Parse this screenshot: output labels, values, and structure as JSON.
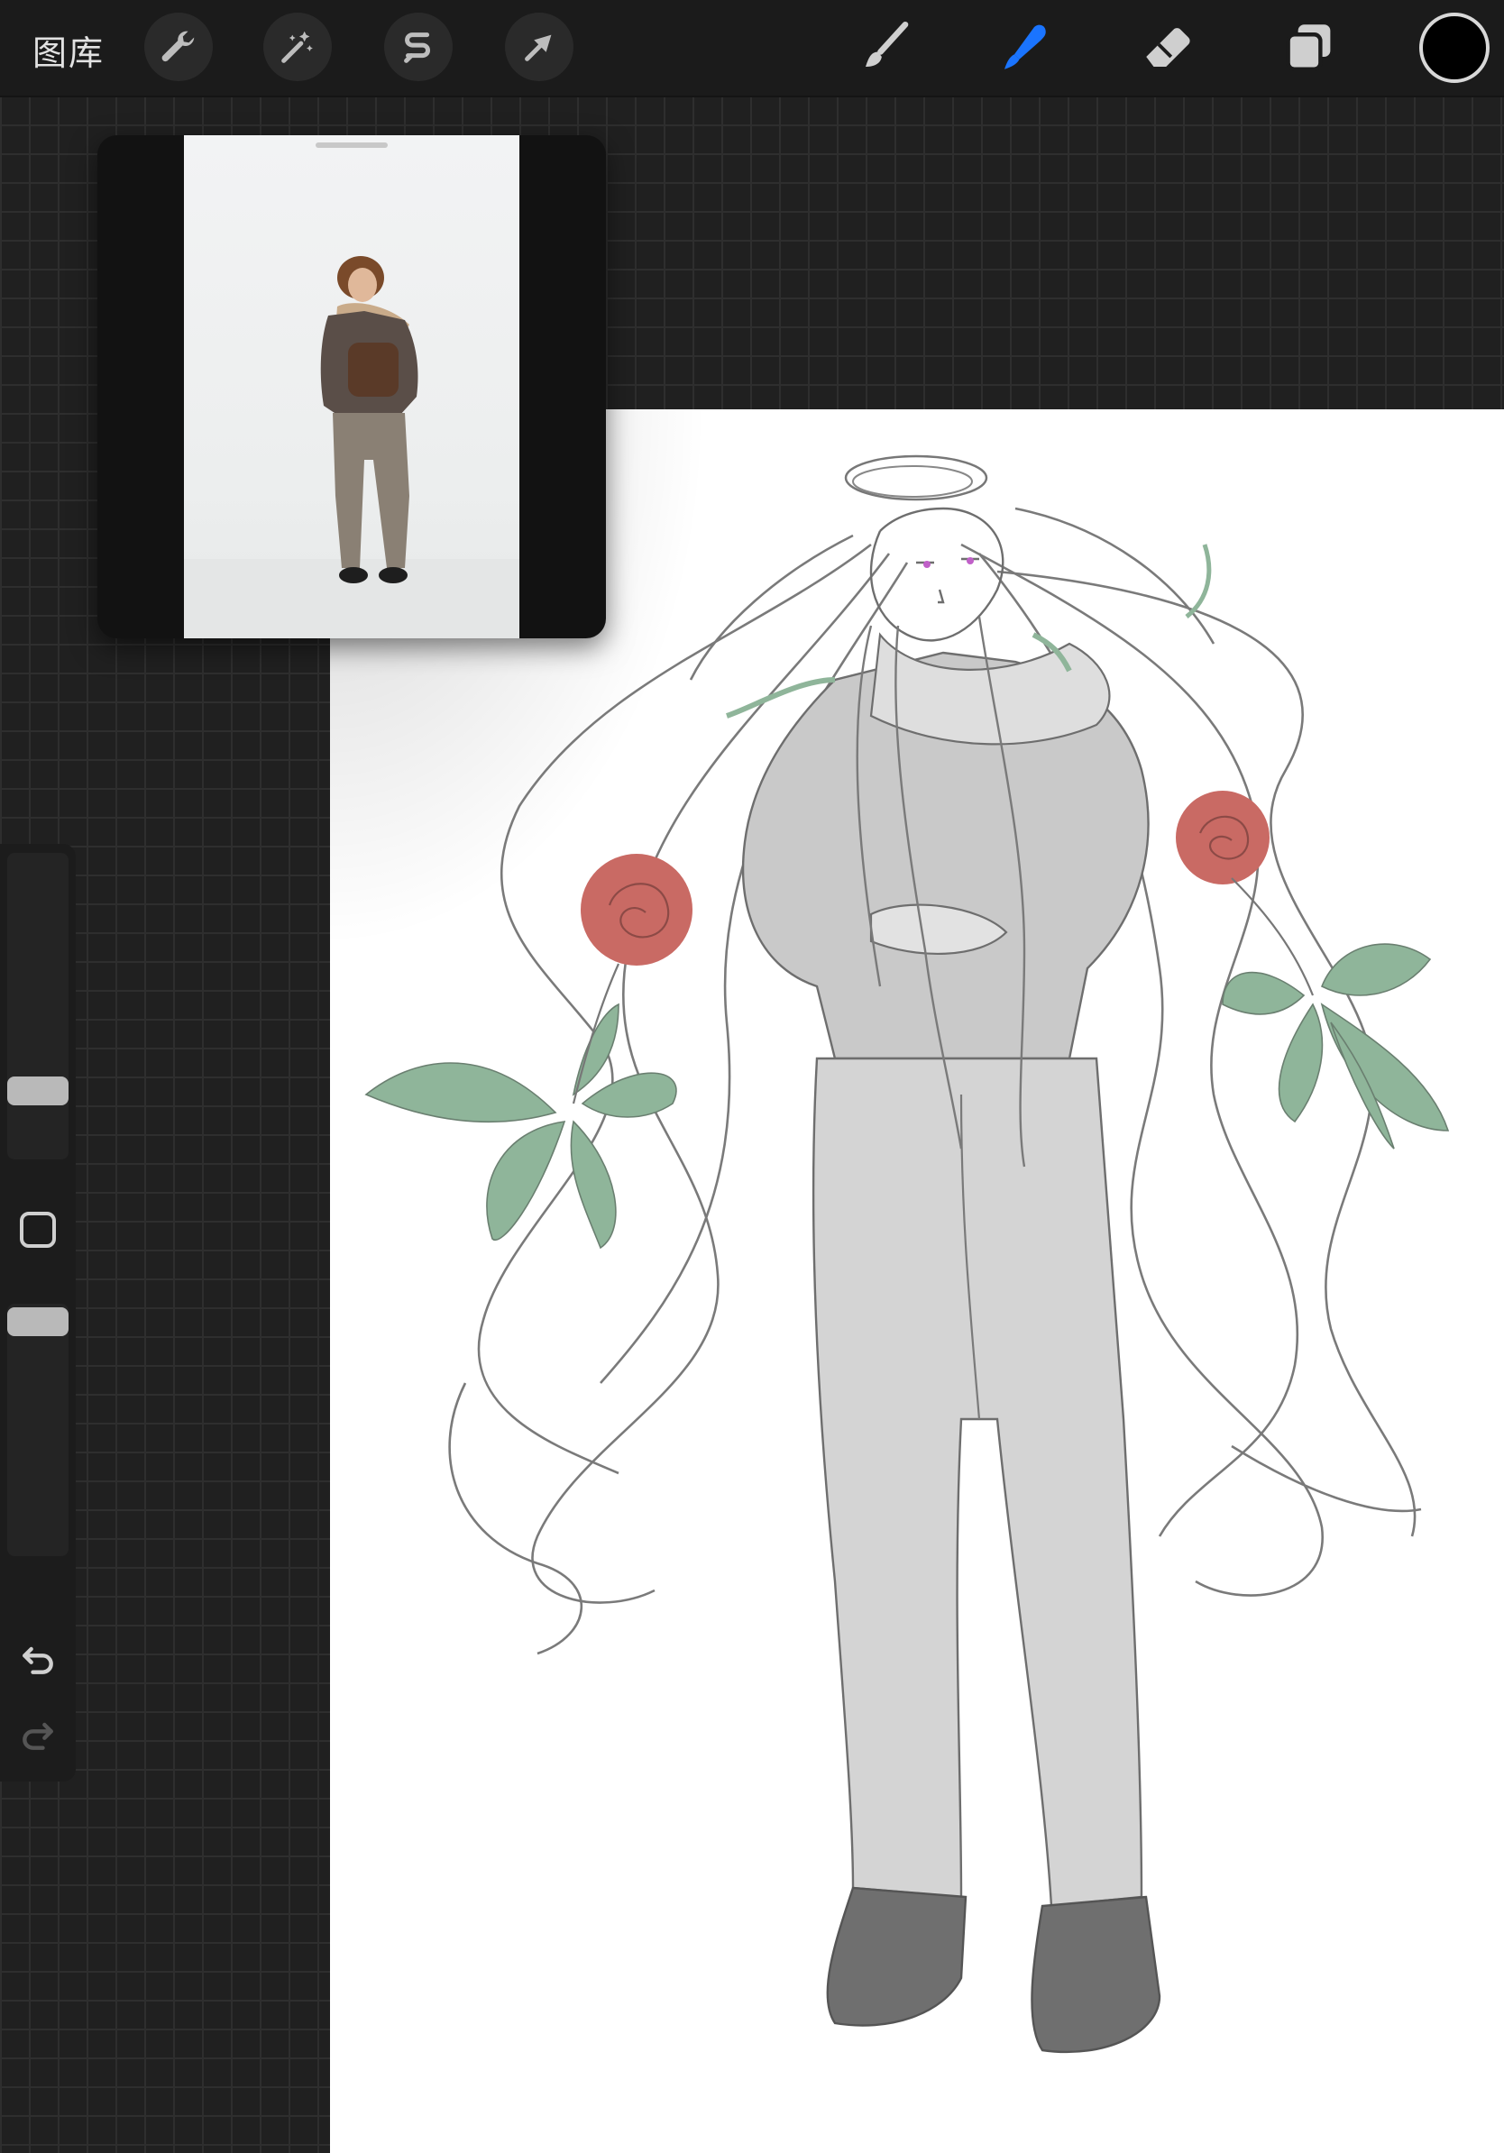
{
  "topbar": {
    "gallery_label": "图库",
    "left_tools": [
      {
        "name": "actions",
        "icon": "wrench-icon"
      },
      {
        "name": "adjustments",
        "icon": "magic-wand-icon"
      },
      {
        "name": "selection",
        "icon": "selection-s-icon"
      },
      {
        "name": "transform",
        "icon": "arrow-cursor-icon"
      }
    ],
    "right_tools": [
      {
        "name": "brush",
        "icon": "brush-icon",
        "active": false
      },
      {
        "name": "smudge",
        "icon": "smudge-finger-icon",
        "active": true
      },
      {
        "name": "eraser",
        "icon": "eraser-icon",
        "active": false
      },
      {
        "name": "layers",
        "icon": "layers-icon",
        "active": false
      }
    ],
    "current_color": "#000000",
    "accent_color": "#1a74ff"
  },
  "sidebar": {
    "brush_size_level": 0.27,
    "opacity_level": 1.0,
    "icons": [
      "modify-square-icon",
      "undo-icon",
      "redo-icon"
    ]
  },
  "reference": {
    "description_visible": false
  },
  "colors": {
    "rose": "#c96a64",
    "leaf": "#8fb59a",
    "sketch": "#6a6a6a",
    "shading": "#c9c9c9"
  }
}
